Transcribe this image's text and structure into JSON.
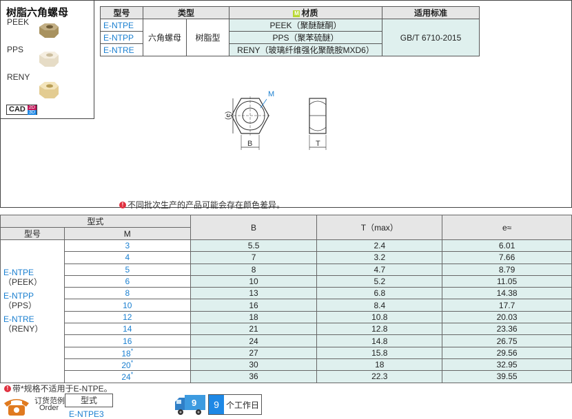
{
  "product": {
    "title": "树脂六角螺母",
    "materials": [
      "PEEK",
      "PPS",
      "RENY"
    ],
    "cad_label": "CAD",
    "cad_2d": "2D",
    "cad_3d": "3D",
    "nut_colors": [
      "#b8a37a",
      "#f1e7d4",
      "#ecd9a8"
    ]
  },
  "spec_table": {
    "headers": {
      "model": "型号",
      "type": "类型",
      "material_chip": "M",
      "material": "材质",
      "standard": "适用标准"
    },
    "type_main": "六角螺母",
    "type_sub": "树脂型",
    "standard": "GB/T 6710-2015",
    "rows": [
      {
        "code": "E-NTPE",
        "material": "PEEK（聚醚醚酮）"
      },
      {
        "code": "E-NTPP",
        "material": "PPS（聚苯硫醚）"
      },
      {
        "code": "E-NTRE",
        "material": "RENY（玻璃纤维强化聚酰胺MXD6）"
      }
    ]
  },
  "drawing": {
    "label_m": "M",
    "label_e": "(e)",
    "label_b": "B",
    "label_t": "T"
  },
  "notice": "不同批次生产的产品可能会存在颜色差异。",
  "dims_table": {
    "headers": {
      "group": "型式",
      "model": "型号",
      "m": "M",
      "b": "B",
      "t": "T（max）",
      "e": "e≈"
    },
    "models": [
      {
        "code": "E-NTPE",
        "mat": "（PEEK）"
      },
      {
        "code": "E-NTPP",
        "mat": "（PPS）"
      },
      {
        "code": "E-NTRE",
        "mat": "（RENY）"
      }
    ],
    "rows": [
      {
        "m": "3",
        "star": "",
        "b": "5.5",
        "t": "2.4",
        "e": "6.01"
      },
      {
        "m": "4",
        "star": "",
        "b": "7",
        "t": "3.2",
        "e": "7.66"
      },
      {
        "m": "5",
        "star": "",
        "b": "8",
        "t": "4.7",
        "e": "8.79"
      },
      {
        "m": "6",
        "star": "",
        "b": "10",
        "t": "5.2",
        "e": "11.05"
      },
      {
        "m": "8",
        "star": "",
        "b": "13",
        "t": "6.8",
        "e": "14.38"
      },
      {
        "m": "10",
        "star": "",
        "b": "16",
        "t": "8.4",
        "e": "17.7"
      },
      {
        "m": "12",
        "star": "",
        "b": "18",
        "t": "10.8",
        "e": "20.03"
      },
      {
        "m": "14",
        "star": "",
        "b": "21",
        "t": "12.8",
        "e": "23.36"
      },
      {
        "m": "16",
        "star": "",
        "b": "24",
        "t": "14.8",
        "e": "26.75"
      },
      {
        "m": "18",
        "star": "*",
        "b": "27",
        "t": "15.8",
        "e": "29.56"
      },
      {
        "m": "20",
        "star": "*",
        "b": "30",
        "t": "18",
        "e": "32.95"
      },
      {
        "m": "24",
        "star": "*",
        "b": "36",
        "t": "22.3",
        "e": "39.55"
      }
    ]
  },
  "footnote": "带*规格不适用于E-NTPE。",
  "order": {
    "label_cn": "订货范例",
    "label_en": "Order",
    "box_label": "型式",
    "example": "E-NTPE3"
  },
  "delivery": {
    "days": "9",
    "label": "个工作日"
  },
  "colors": {
    "accent_blue": "#1a7fd0",
    "teal_cell": "#dff0ee",
    "header_gray": "#e6e6e6",
    "warn_red": "#e0303f",
    "material_green": "#b8d830"
  }
}
